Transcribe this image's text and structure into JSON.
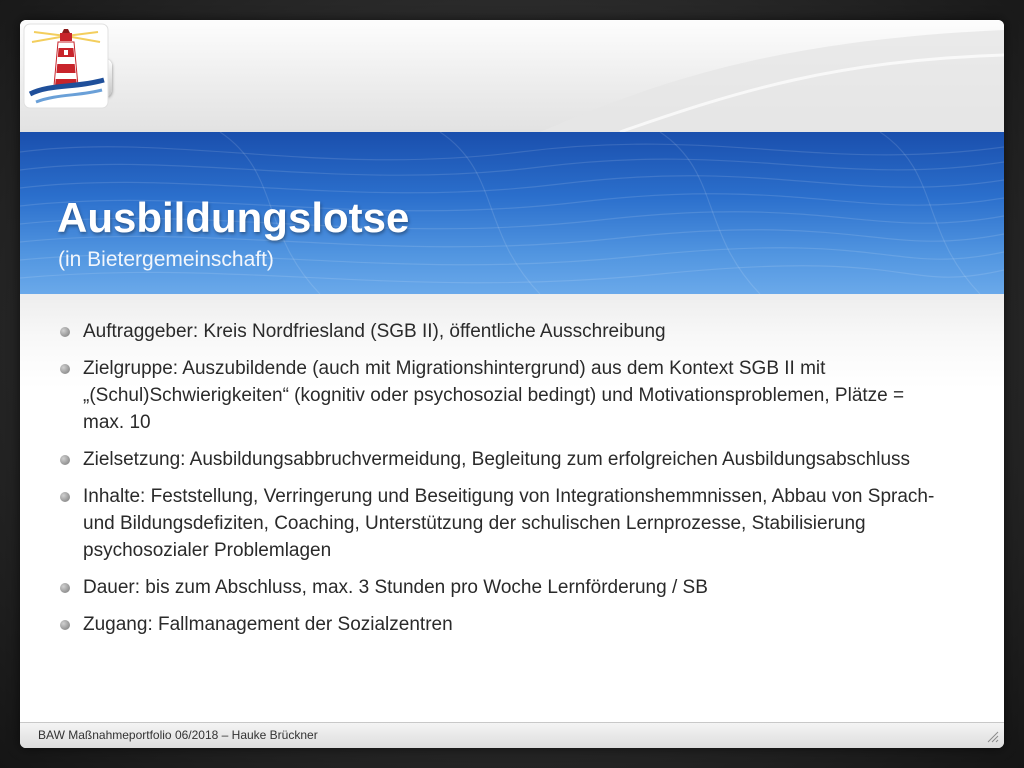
{
  "slide": {
    "title": "Ausbildungslotse",
    "subtitle": "(in Bietergemeinschaft)",
    "bullets": [
      "Auftraggeber: Kreis Nordfriesland (SGB II), öffentliche Ausschreibung",
      "Zielgruppe: Auszubildende (auch mit Migrationshintergrund) aus dem Kontext SGB II mit „(Schul)Schwierigkeiten“ (kognitiv oder psychosozial bedingt) und Motivationsproblemen, Plätze = max. 10",
      "Zielsetzung: Ausbildungsabbruchvermeidung, Begleitung zum erfolgreichen Ausbildungsabschluss",
      "Inhalte: Feststellung, Verringerung und Beseitigung von Integrationshemmnissen, Abbau von Sprach- und Bildungsdefiziten, Coaching, Unterstützung der schulischen Lernprozesse, Stabilisierung psychosozialer Problemlagen",
      "Dauer: bis zum Abschluss, max. 3  Stunden pro Woche Lernförderung / SB",
      "Zugang:  Fallmanagement der Sozialzentren"
    ],
    "footer": "BAW Maßnahmeportfolio 06/2018 – Hauke Brückner"
  },
  "icons": {
    "home": "home-icon",
    "logo": "lighthouse-logo",
    "bullet": "bullet-dot",
    "grip": "resize-grip-icon"
  },
  "colors": {
    "title_band": "#2b6fcc",
    "title_text": "#ffffff",
    "body_text": "#2a2a2a",
    "lighthouse_red": "#c8242b"
  }
}
